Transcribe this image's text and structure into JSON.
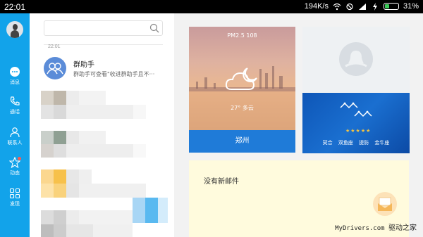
{
  "status_bar": {
    "time": "22:01",
    "network_speed": "194K/s",
    "battery_percent": "31%",
    "battery_level": 0.31
  },
  "nav": {
    "items": [
      {
        "label": "消息",
        "icon": "chat-bubble-icon"
      },
      {
        "label": "通话",
        "icon": "phone-icon"
      },
      {
        "label": "联系人",
        "icon": "contact-icon"
      },
      {
        "label": "动态",
        "icon": "star-icon"
      },
      {
        "label": "发现",
        "icon": "grid-icon"
      }
    ]
  },
  "messages": {
    "search_placeholder": "",
    "timestamp": "22:01",
    "conversation": {
      "title": "群助手",
      "snippet": "群助手可查看\"收进群助手且不···"
    }
  },
  "widgets": {
    "weather": {
      "pm": "PM2.5 108",
      "condition": "27° 多云",
      "city": "郑州"
    },
    "horoscope": {
      "rating": "★★★★★",
      "tags": [
        "契合",
        "双鱼座",
        "提防",
        "金牛座"
      ]
    },
    "mail": {
      "message": "没有新邮件"
    }
  },
  "watermark": {
    "site": "MyDrivers.com",
    "name": "驱动之家"
  },
  "colors": {
    "rail": "#12a3ea",
    "city_bar": "#1f7bd8",
    "mail_tile": "#fffbdd"
  }
}
